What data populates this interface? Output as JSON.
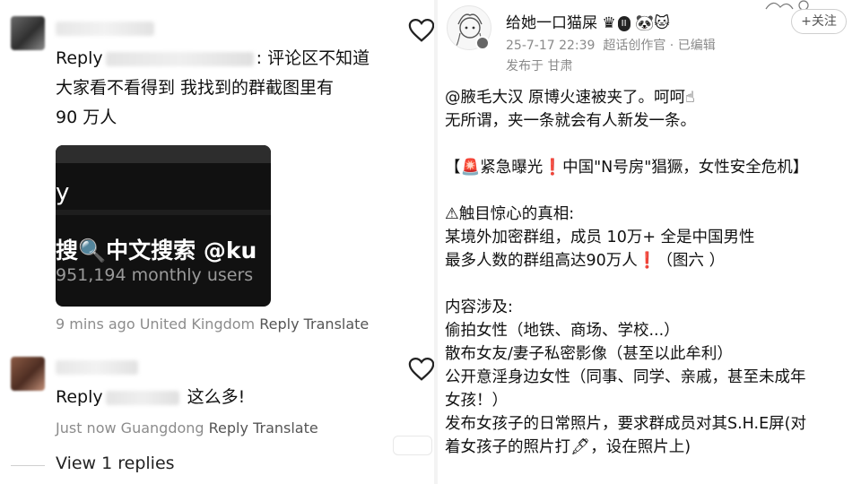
{
  "left": {
    "comment1": {
      "reply_prefix": "Reply",
      "text_after_name": ": 评论区不知道",
      "line2": "大家看不看得到 我找到的群截图里有",
      "line3": "90 万人",
      "screenshot": {
        "partial_text": "y",
        "title": "搜🔍中文搜索 @ku",
        "subtitle": "951,194 monthly users"
      },
      "meta_time": "9 mins ago",
      "meta_location": "United Kingdom",
      "reply_label": "Reply",
      "translate_label": "Translate"
    },
    "comment2": {
      "reply_prefix": "Reply",
      "text_after_name": "这么多!",
      "meta_time": "Just now",
      "meta_location": "Guangdong",
      "reply_label": "Reply",
      "translate_label": "Translate"
    },
    "view_replies": "View 1 replies"
  },
  "right": {
    "username": "给她一口猫屎",
    "badge": "II",
    "follow_label": "+关注",
    "timestamp": "25-7-17 22:39",
    "source": "超话创作官",
    "edited": "已编辑",
    "location": "发布于 甘肃",
    "lines": [
      "@腋毛大汉 原博火速被夹了。呵呵☝",
      "无所谓，夹一条就会有人新发一条。",
      "",
      "【🚨紧急曝光❗中国\"N号房\"猖獗，女性安全危机】",
      "",
      "⚠触目惊心的真相:",
      "某境外加密群组，成员 10万+ 全是中国男性",
      "最多人数的群组高达90万人❗（图六 ）",
      "",
      "内容涉及:",
      "偷拍女性（地铁、商场、学校...）",
      "散布女友/妻子私密影像（甚至以此牟利）",
      "公开意淫身边女性（同事、同学、亲戚，甚至未成年",
      "女孩！）",
      "发布女孩子的日常照片，要求群成员对其S.H.E屏(对",
      "着女孩子的照片打🖋，设在照片上)"
    ]
  }
}
